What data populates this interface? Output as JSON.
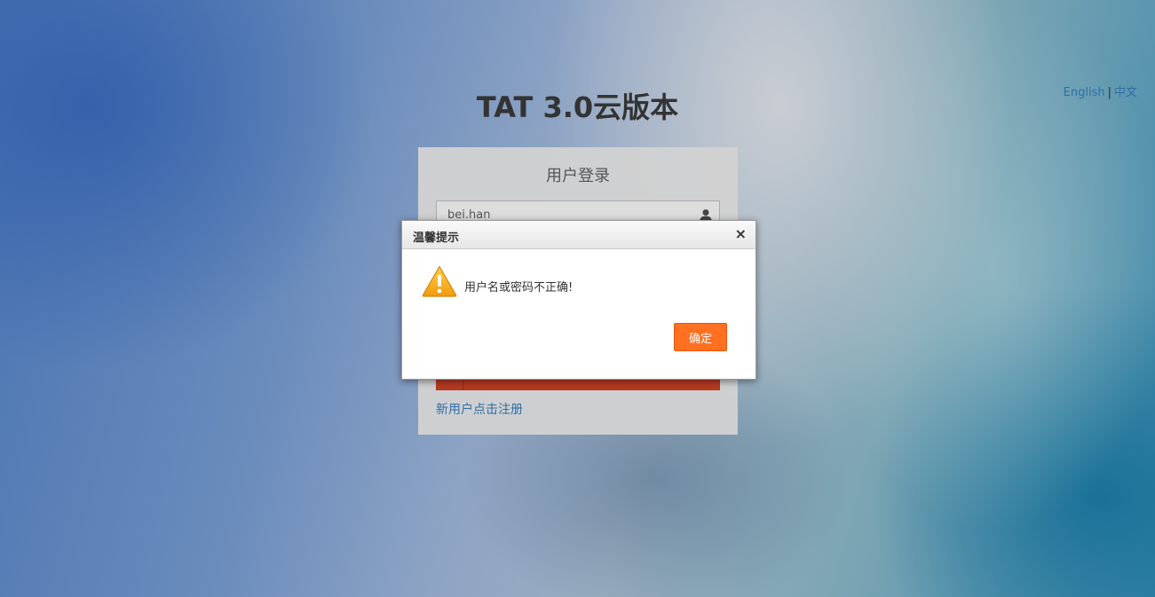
{
  "language_switch": {
    "english": "English",
    "separator": "|",
    "chinese": "中文"
  },
  "app_title": "TAT 3.0云版本",
  "login": {
    "heading": "用户登录",
    "username_value": "bei.han",
    "register_link": "新用户点击注册"
  },
  "dialog": {
    "title": "温馨提示",
    "close": "×",
    "message": "用户名或密码不正确!",
    "confirm": "确定",
    "icon": "warning-icon"
  },
  "colors": {
    "confirm_button": "#ff7020",
    "login_button": "#b53a22",
    "link": "#2f6fa6"
  }
}
